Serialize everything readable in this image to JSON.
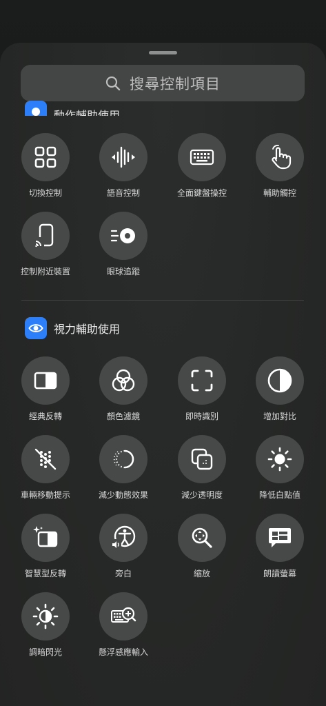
{
  "search": {
    "placeholder": "搜尋控制項目"
  },
  "motor_section": {
    "title": "動作輔助使用",
    "items": [
      {
        "label": "切換控制",
        "icon": "grid-icon"
      },
      {
        "label": "語音控制",
        "icon": "waveform-icon"
      },
      {
        "label": "全面鍵盤操控",
        "icon": "keyboard-icon"
      },
      {
        "label": "輔助觸控",
        "icon": "hand-pointer-icon"
      },
      {
        "label": "控制附近裝置",
        "icon": "phone-cast-icon"
      },
      {
        "label": "眼球追蹤",
        "icon": "eye-tracking-icon"
      }
    ]
  },
  "vision_section": {
    "title": "視力輔助使用",
    "icon": "eye-icon",
    "items": [
      {
        "label": "經典反轉",
        "icon": "classic-invert-icon"
      },
      {
        "label": "顏色濾鏡",
        "icon": "color-filters-icon"
      },
      {
        "label": "即時識別",
        "icon": "live-recognition-icon"
      },
      {
        "label": "增加對比",
        "icon": "contrast-icon"
      },
      {
        "label": "車輛移動提示",
        "icon": "vehicle-motion-icon"
      },
      {
        "label": "減少動態效果",
        "icon": "reduce-motion-icon"
      },
      {
        "label": "減少透明度",
        "icon": "reduce-transparency-icon"
      },
      {
        "label": "降低白點值",
        "icon": "white-point-icon"
      },
      {
        "label": "智慧型反轉",
        "icon": "smart-invert-icon"
      },
      {
        "label": "旁白",
        "icon": "voiceover-icon"
      },
      {
        "label": "縮放",
        "icon": "zoom-icon"
      },
      {
        "label": "朗讀螢幕",
        "icon": "speak-screen-icon"
      },
      {
        "label": "調暗閃光",
        "icon": "dim-flashing-icon"
      },
      {
        "label": "懸浮感應輸入",
        "icon": "hover-typing-icon"
      }
    ]
  },
  "colors": {
    "accent": "#2d7ff9",
    "button": "#474949",
    "sheet": "#262827"
  }
}
